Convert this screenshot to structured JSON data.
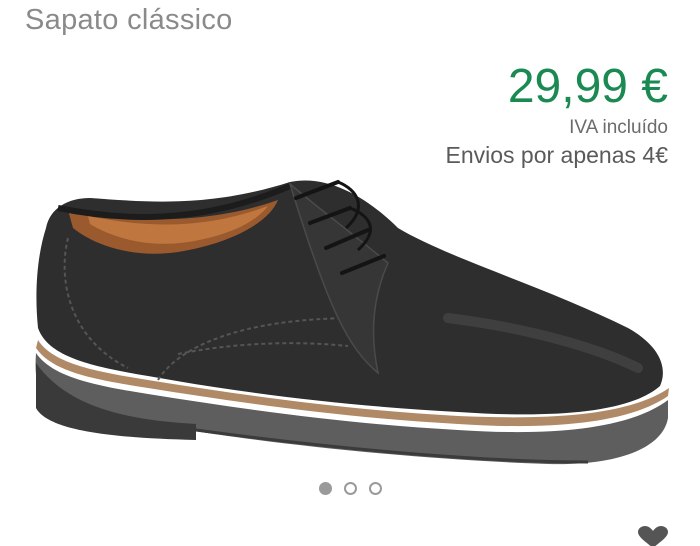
{
  "product": {
    "title": "Sapato clássico",
    "price": "29,99 €",
    "vat_note": "IVA incluído",
    "shipping_note": "Envios por apenas 4€"
  },
  "gallery": {
    "image_icon": "shoe-image",
    "dots": [
      {
        "state": "active"
      },
      {
        "state": "inactive"
      },
      {
        "state": "inactive"
      }
    ],
    "current_index": 1,
    "total": 3
  },
  "actions": {
    "favorite_icon": "heart-icon"
  },
  "colors": {
    "price": "#1a8a52",
    "title": "#8a8a8a",
    "dot": "#9a9a9a"
  }
}
